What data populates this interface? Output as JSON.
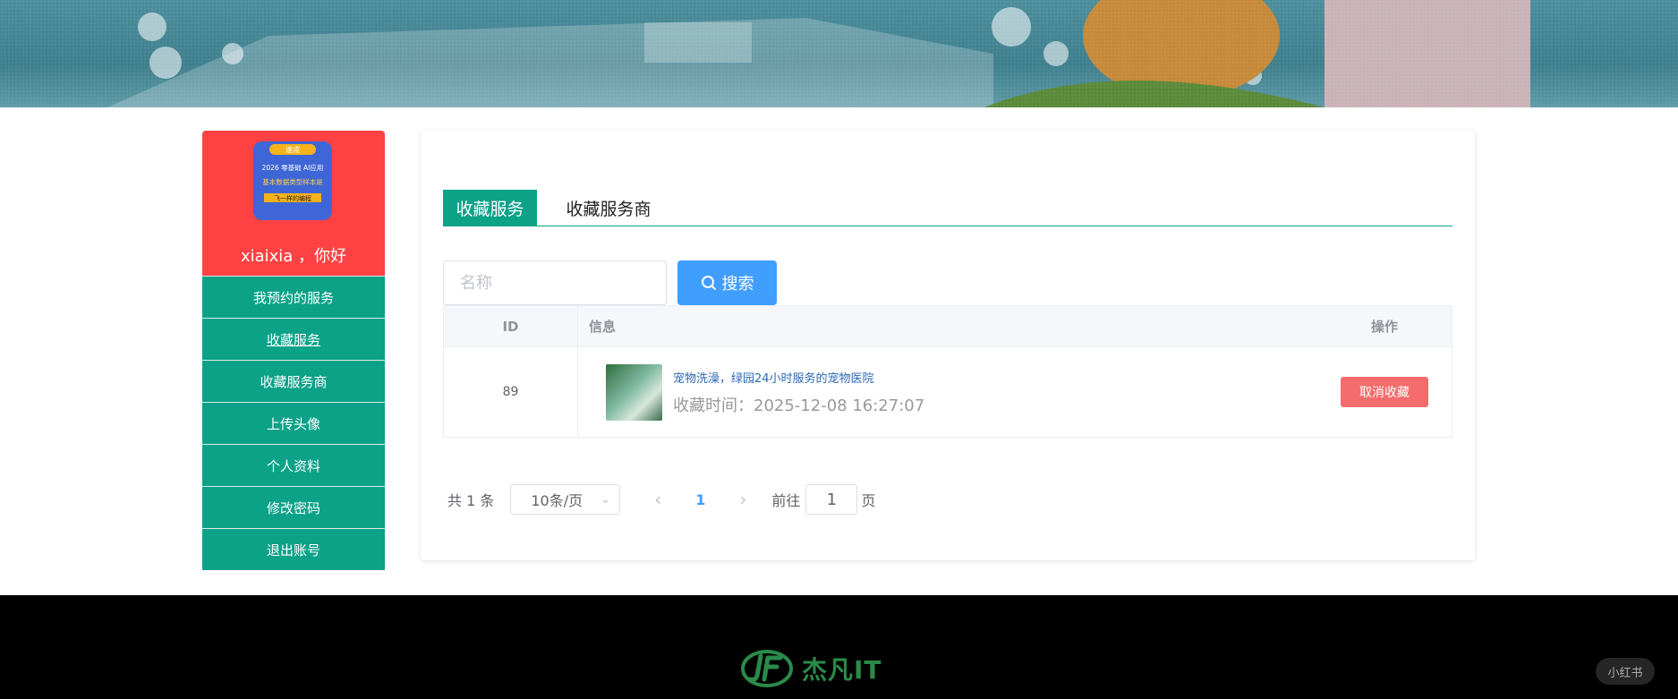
{
  "sidebar": {
    "greeting": "xiaixia ，你好",
    "avatar_lines": [
      "速成",
      "2026 零基础 AI应用",
      "基本数据类型样本是",
      "飞一样的编程"
    ],
    "items": [
      {
        "label": "我预约的服务"
      },
      {
        "label": "收藏服务"
      },
      {
        "label": "收藏服务商"
      },
      {
        "label": "上传头像"
      },
      {
        "label": "个人资料"
      },
      {
        "label": "修改密码"
      },
      {
        "label": "退出账号"
      }
    ]
  },
  "tabs": [
    {
      "label": "收藏服务"
    },
    {
      "label": "收藏服务商"
    }
  ],
  "search": {
    "placeholder": "名称",
    "value": "",
    "button_label": "搜索"
  },
  "table": {
    "headers": {
      "id": "ID",
      "info": "信息",
      "op": "操作"
    },
    "rows": [
      {
        "id": "89",
        "title": "宠物洗澡，绿园24小时服务的宠物医院",
        "time": "收藏时间：2025-12-08 16:27:07",
        "action": "取消收藏"
      }
    ]
  },
  "pagination": {
    "total": "共 1 条",
    "page_size": "10条/页",
    "current": "1",
    "goto_prefix": "前往",
    "goto_value": "1",
    "goto_suffix": "页"
  },
  "footer": {
    "logo_text": "杰凡IT",
    "watermark": "小红书"
  },
  "colors": {
    "accent_green": "#0ba288",
    "profile_red": "#fe4142",
    "primary_blue": "#409eff",
    "danger": "#f56c6c"
  }
}
